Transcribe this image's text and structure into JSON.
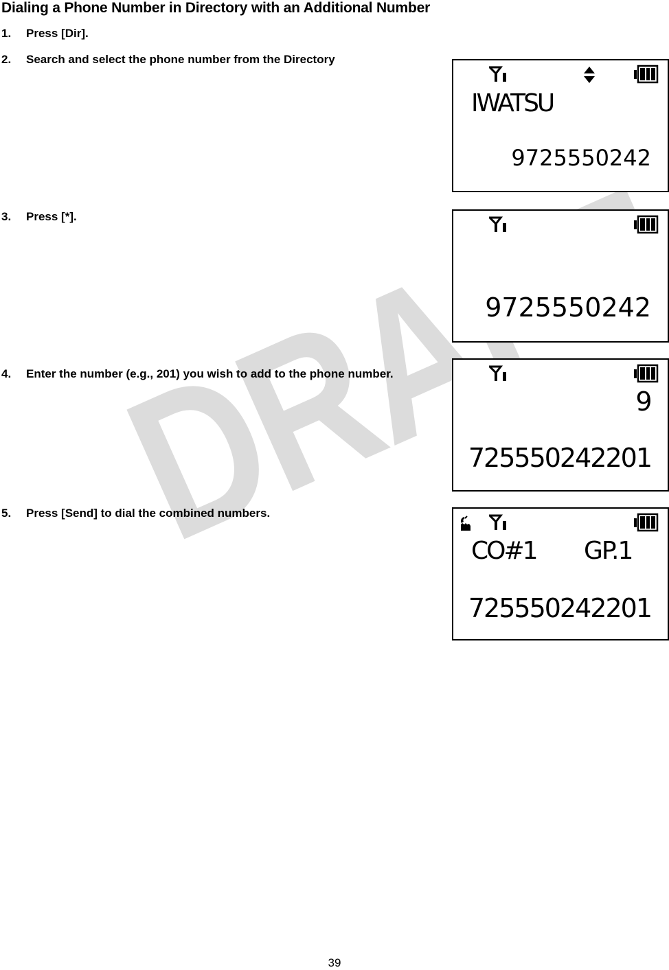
{
  "watermark": "DRAFT",
  "title": "Dialing a Phone Number in Directory with an Additional Number",
  "steps": [
    {
      "num": "1.",
      "text": "Press [Dir]."
    },
    {
      "num": "2.",
      "text": "Search and select the phone number from the Directory"
    },
    {
      "num": "3.",
      "text": "Press [*]."
    },
    {
      "num": "4.",
      "text": "Enter the number (e.g., 201) you wish to add to the phone number."
    },
    {
      "num": "5.",
      "text": "Press [Send] to dial the combined numbers."
    }
  ],
  "screens": [
    {
      "icons": [
        "antenna-signal-icon",
        "scroll-up-down-icon",
        "battery-full-icon"
      ],
      "name": "IWATSU",
      "number": "9725550242"
    },
    {
      "icons": [
        "antenna-signal-icon",
        "battery-full-icon"
      ],
      "number": "9725550242"
    },
    {
      "icons": [
        "antenna-signal-icon",
        "battery-full-icon"
      ],
      "prefix": "9",
      "number": "725550242201"
    },
    {
      "icons": [
        "handset-off-hook-icon",
        "antenna-signal-icon",
        "battery-full-icon"
      ],
      "line_label": "CO#1",
      "group": "GP.1",
      "number": "725550242201"
    }
  ],
  "page_number": "39",
  "colors": {
    "watermark": "#dcdcdc",
    "text": "#000000",
    "lcd_border": "#000000"
  }
}
